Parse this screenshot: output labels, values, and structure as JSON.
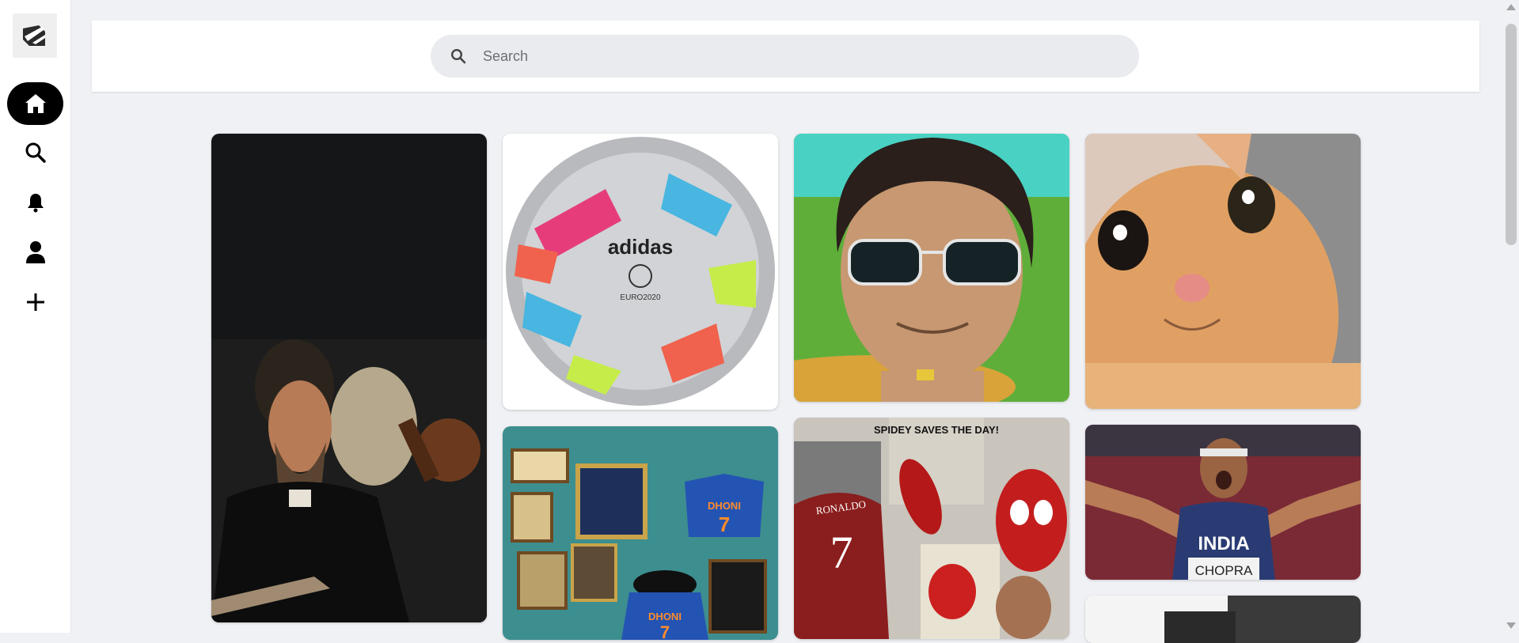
{
  "sidebar": {
    "logo_icon": "pinned-logo-icon",
    "items": [
      {
        "name": "home",
        "icon": "home-icon",
        "active": true
      },
      {
        "name": "search",
        "icon": "search-icon",
        "active": false
      },
      {
        "name": "notifications",
        "icon": "bell-icon",
        "active": false
      },
      {
        "name": "profile",
        "icon": "user-icon",
        "active": false
      },
      {
        "name": "create",
        "icon": "plus-icon",
        "active": false
      }
    ]
  },
  "search": {
    "placeholder": "Search",
    "value": ""
  },
  "pins": [
    {
      "alt": "Self-portrait with Death playing the fiddle painting"
    },
    {
      "alt": "adidas UEFA Euro 2020 football"
    },
    {
      "alt": "Cartoon boy with sunglasses"
    },
    {
      "alt": "Smiling orange kitten close-up"
    },
    {
      "alt": "Dhoni jersey 7 framed memorabilia wall"
    },
    {
      "alt": "Ronaldo 7 and Spider-Man collage"
    },
    {
      "alt": "Athlete in INDIA CHOPRA jersey celebrating"
    },
    {
      "alt": "Next pin partially visible"
    }
  ],
  "image_text": {
    "ball_brand": "adidas",
    "ball_event": "EURO2020",
    "dhoni_jersey_name": "DHONI",
    "dhoni_jersey_number": "7",
    "ronaldo_name": "RONALDO",
    "ronaldo_number": "7",
    "spidey_banner": "SPIDEY SAVES THE DAY!",
    "chopra_country": "INDIA",
    "chopra_name": "CHOPRA"
  },
  "colors": {
    "background": "#f0f1f5",
    "active_nav": "#000000",
    "search_bg": "#e9ebee"
  }
}
